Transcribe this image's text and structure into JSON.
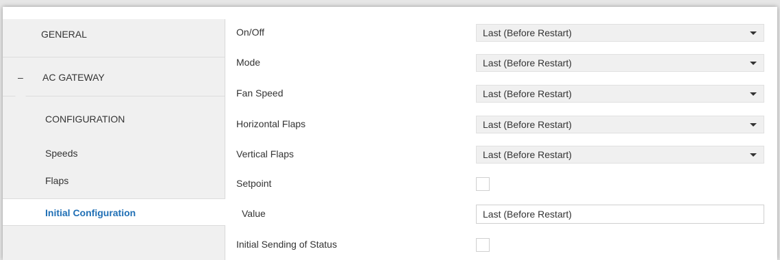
{
  "sidebar": {
    "general": "GENERAL",
    "ac_gateway": {
      "toggle": "–",
      "label": "AC GATEWAY"
    },
    "items": [
      "CONFIGURATION",
      "Speeds",
      "Flaps",
      "Initial Configuration"
    ]
  },
  "form": {
    "on_off": {
      "label": "On/Off",
      "value": "Last (Before Restart)"
    },
    "mode": {
      "label": "Mode",
      "value": "Last (Before Restart)"
    },
    "fan_speed": {
      "label": "Fan Speed",
      "value": "Last (Before Restart)"
    },
    "horizontal_flaps": {
      "label": "Horizontal Flaps",
      "value": "Last (Before Restart)"
    },
    "vertical_flaps": {
      "label": "Vertical Flaps",
      "value": "Last (Before Restart)"
    },
    "setpoint": {
      "label": "Setpoint",
      "checked": false
    },
    "value": {
      "label": "Value",
      "value": "Last (Before Restart)"
    },
    "initial_sending": {
      "label": "Initial Sending of Status",
      "checked": false
    }
  },
  "colors": {
    "accent": "#1f6fb5",
    "sidebar_bg": "#f0f0f0",
    "select_bg": "#f0f0f0"
  }
}
